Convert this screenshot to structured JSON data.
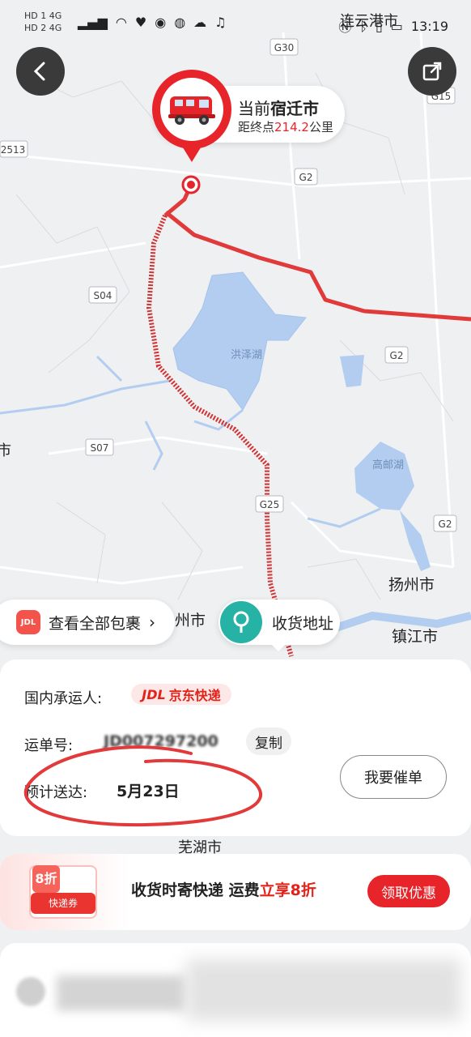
{
  "status_bar": {
    "left_top": "HD 1 4G",
    "left_bottom": "HD 2 4G",
    "time": "13:19"
  },
  "map": {
    "road_labels": [
      "G30",
      "G15",
      "G2",
      "2513",
      "S04",
      "G2",
      "S07",
      "G25",
      "G2"
    ],
    "place_labels": {
      "lianyungang": "连云港市",
      "hongze_lake": "洪泽湖",
      "gaoyou_lake": "高邮湖",
      "yangzhou": "扬州市",
      "zhenjiang": "镇江市",
      "zhou": "州市",
      "wuhu": "芜湖市",
      "left_edge": "市"
    }
  },
  "nav": {
    "back_icon": "chevron-left-icon",
    "share_icon": "share-icon"
  },
  "location_pin": {
    "prefix": "当前",
    "city": "宿迁市",
    "distance_prefix": "距终点",
    "distance_value": "214.2",
    "distance_unit": "公里"
  },
  "packages_pill": {
    "label": "查看全部包裹",
    "arrow": "›",
    "logo_text": "JDL"
  },
  "address_pill": {
    "label": "收货地址"
  },
  "shipment": {
    "carrier_label": "国内承运人:",
    "carrier_badge_logo": "JDL",
    "carrier_badge_text": "京东快递",
    "tracking_label": "运单号:",
    "tracking_value": "JD007297200",
    "copy_button": "复制",
    "eta_label": "预计送达:",
    "eta_value": "5月23日",
    "urge_button": "我要催单"
  },
  "promo": {
    "coupon_discount": "8折",
    "coupon_label": "快递券",
    "text_main": "收货时寄快递 运费",
    "text_highlight": "立享8折",
    "button": "领取优惠"
  },
  "colors": {
    "accent": "#e8242b",
    "route": "#e03a3a",
    "water": "#b3cdf1",
    "pin_green": "#27b2a6"
  }
}
